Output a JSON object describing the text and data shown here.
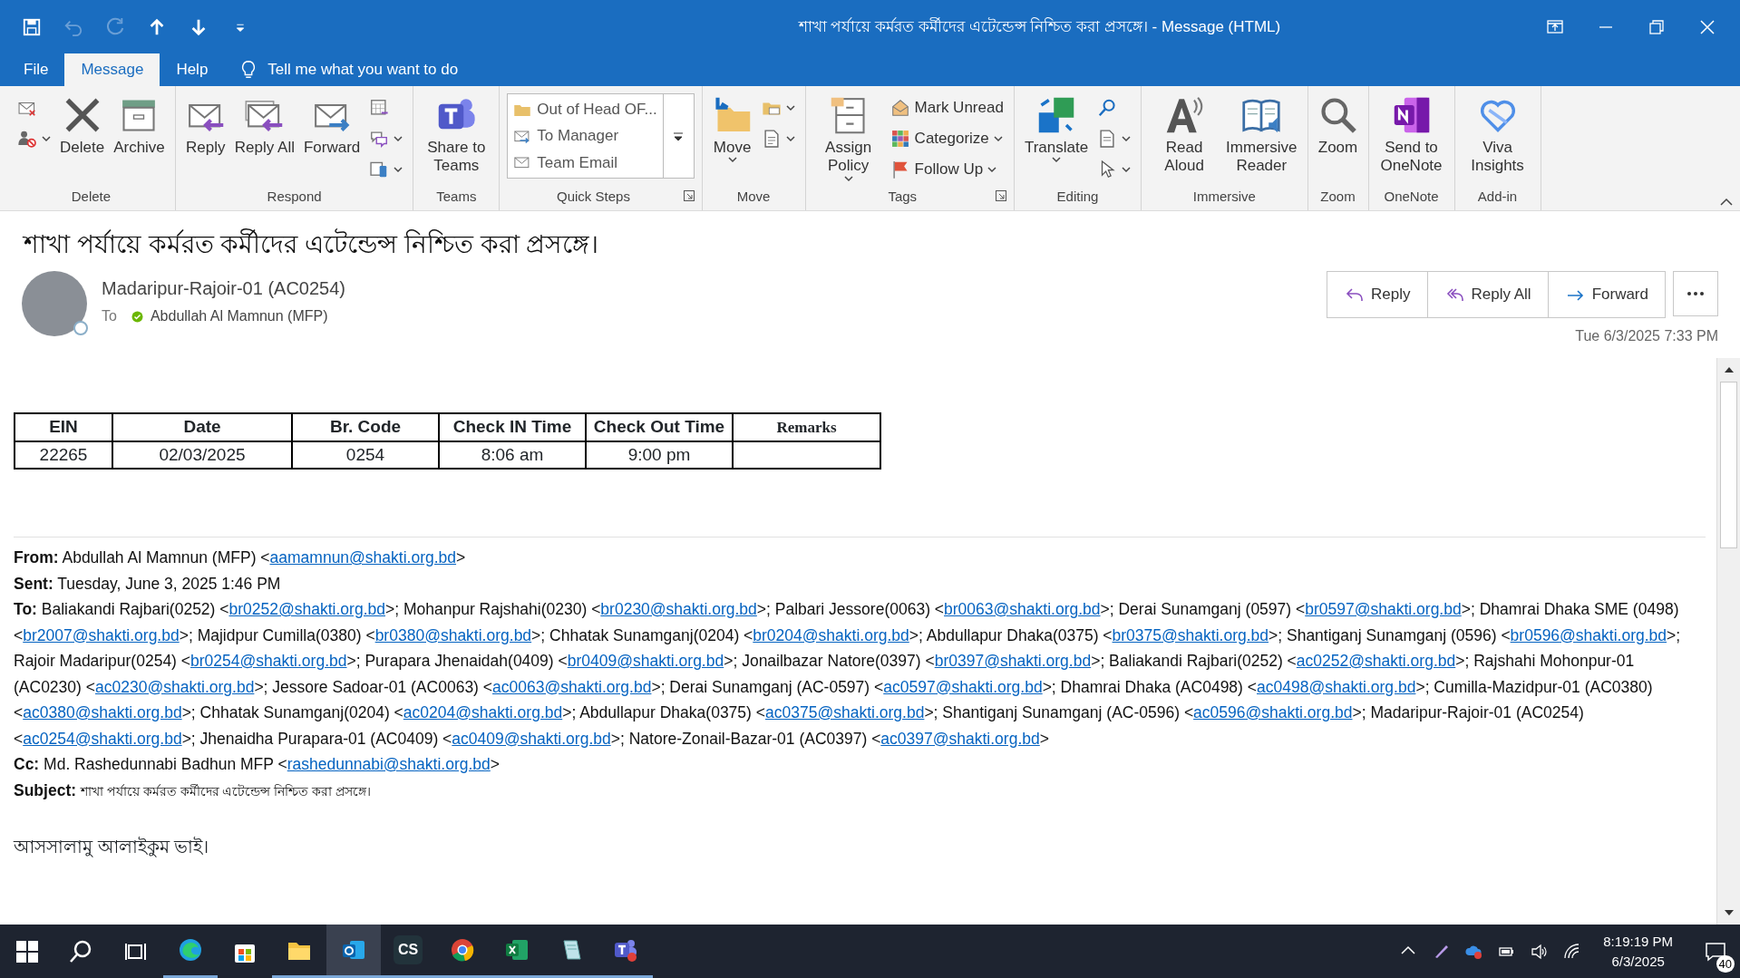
{
  "window": {
    "title": "শাখা পর্যায়ে কর্মরত কর্মীদের এটেন্ডেন্স নিশ্চিত করা প্রসঙ্গে।  -  Message (HTML)"
  },
  "quick_access": [
    {
      "disabled": false
    },
    {
      "disabled": true
    },
    {
      "disabled": true
    },
    {
      "disabled": false
    },
    {
      "disabled": false
    },
    {
      "disabled": false
    }
  ],
  "menu_tabs": [
    {
      "label": "File",
      "selected": false
    },
    {
      "label": "Message",
      "selected": true
    },
    {
      "label": "Help",
      "selected": false
    }
  ],
  "tell_me": {
    "placeholder": "Tell me what you want to do"
  },
  "ribbon_groups": [
    {
      "label": "Delete",
      "launcher": false,
      "items": [
        {
          "kind": "stack",
          "items": [
            {
              "dropdown": false
            },
            {
              "dropdown": true
            }
          ]
        },
        {
          "kind": "large",
          "label": "Delete",
          "dropdown": false
        },
        {
          "kind": "large",
          "label": "Archive",
          "dropdown": false
        }
      ]
    },
    {
      "label": "Respond",
      "launcher": false,
      "items": [
        {
          "kind": "large",
          "label": "Reply",
          "dropdown": false
        },
        {
          "kind": "large",
          "label": "Reply All",
          "dropdown": false
        },
        {
          "kind": "large",
          "label": "Forward",
          "dropdown": false
        },
        {
          "kind": "stack",
          "items": [
            {
              "dropdown": false
            },
            {
              "dropdown": true
            },
            {
              "dropdown": true
            }
          ]
        }
      ]
    },
    {
      "label": "Teams",
      "launcher": false,
      "items": [
        {
          "kind": "large",
          "label": "Share to Teams",
          "dropdown": false
        }
      ]
    },
    {
      "label": "Quick Steps",
      "launcher": true,
      "items": [
        {
          "kind": "gallery",
          "items": [
            {
              "label": "Out of Head OF..."
            },
            {
              "label": "To Manager"
            },
            {
              "label": "Team Email"
            }
          ]
        }
      ]
    },
    {
      "label": "Move",
      "launcher": false,
      "items": [
        {
          "kind": "large",
          "label": "Move",
          "dropdown": true
        },
        {
          "kind": "stack",
          "items": [
            {
              "dropdown": true
            },
            {
              "dropdown": true
            }
          ]
        }
      ]
    },
    {
      "label": "Tags",
      "launcher": true,
      "items": [
        {
          "kind": "large",
          "label": "Assign Policy",
          "dropdown": true
        },
        {
          "kind": "stack",
          "items": [
            {
              "label": "Mark Unread",
              "dropdown": false
            },
            {
              "label": "Categorize",
              "dropdown": true
            },
            {
              "label": "Follow Up",
              "dropdown": true
            }
          ]
        }
      ]
    },
    {
      "label": "Editing",
      "launcher": false,
      "items": [
        {
          "kind": "large",
          "label": "Translate",
          "dropdown": true
        },
        {
          "kind": "stack",
          "items": [
            {
              "dropdown": false
            },
            {
              "dropdown": true
            },
            {
              "dropdown": true
            }
          ]
        }
      ]
    },
    {
      "label": "Immersive",
      "launcher": false,
      "items": [
        {
          "kind": "large",
          "label": "Read Aloud",
          "dropdown": false
        },
        {
          "kind": "large",
          "label": "Immersive Reader",
          "dropdown": false
        }
      ]
    },
    {
      "label": "Zoom",
      "launcher": false,
      "items": [
        {
          "kind": "large",
          "label": "Zoom",
          "dropdown": false
        }
      ]
    },
    {
      "label": "OneNote",
      "launcher": false,
      "items": [
        {
          "kind": "large",
          "label": "Send to OneNote",
          "dropdown": false
        }
      ]
    },
    {
      "label": "Add-in",
      "launcher": false,
      "items": [
        {
          "kind": "large",
          "label": "Viva Insights",
          "dropdown": false
        }
      ]
    }
  ],
  "message": {
    "subject": "শাখা পর্যায়ে কর্মরত কর্মীদের এটেন্ডেন্স নিশ্চিত করা প্রসঙ্গে।",
    "sender": "Madaripur-Rajoir-01 (AC0254)",
    "to_label": "To",
    "recipient": "Abdullah Al Mamnun (MFP)",
    "actions": [
      {
        "label": "Reply"
      },
      {
        "label": "Reply All"
      },
      {
        "label": "Forward"
      }
    ],
    "date": "Tue 6/3/2025 7:33 PM"
  },
  "table": {
    "columns": [
      "EIN",
      "Date",
      "Br. Code",
      "Check IN Time",
      "Check Out Time",
      "Remarks"
    ],
    "rows": [
      [
        "22265",
        "02/03/2025",
        "0254",
        "8:06 am",
        "9:00 pm",
        ""
      ]
    ]
  },
  "forward_header": [
    {
      "label": "From:",
      "segments": [
        {
          "kind": "text",
          "text": "Abdullah Al Mamnun (MFP) <"
        },
        {
          "kind": "link",
          "text": "aamamnun@shakti.org.bd"
        },
        {
          "kind": "text",
          "text": ">"
        }
      ]
    },
    {
      "label": "Sent:",
      "segments": [
        {
          "kind": "text",
          "text": "Tuesday, June 3, 2025 1:46 PM"
        }
      ]
    },
    {
      "label": "To:",
      "segments": [
        {
          "kind": "text",
          "text": "Baliakandi Rajbari(0252) <"
        },
        {
          "kind": "link",
          "text": "br0252@shakti.org.bd"
        },
        {
          "kind": "text",
          "text": ">; Mohanpur Rajshahi(0230) <"
        },
        {
          "kind": "link",
          "text": "br0230@shakti.org.bd"
        },
        {
          "kind": "text",
          "text": ">; Palbari Jessore(0063) <"
        },
        {
          "kind": "link",
          "text": "br0063@shakti.org.bd"
        },
        {
          "kind": "text",
          "text": ">; Derai Sunamganj (0597) <"
        },
        {
          "kind": "link",
          "text": "br0597@shakti.org.bd"
        },
        {
          "kind": "text",
          "text": ">; Dhamrai Dhaka SME (0498) <"
        },
        {
          "kind": "link",
          "text": "br2007@shakti.org.bd"
        },
        {
          "kind": "text",
          "text": ">; Majidpur Cumilla(0380) <"
        },
        {
          "kind": "link",
          "text": "br0380@shakti.org.bd"
        },
        {
          "kind": "text",
          "text": ">; Chhatak Sunamganj(0204) <"
        },
        {
          "kind": "link",
          "text": "br0204@shakti.org.bd"
        },
        {
          "kind": "text",
          "text": ">; Abdullapur Dhaka(0375) <"
        },
        {
          "kind": "link",
          "text": "br0375@shakti.org.bd"
        },
        {
          "kind": "text",
          "text": ">; Shantiganj Sunamganj (0596) <"
        },
        {
          "kind": "link",
          "text": "br0596@shakti.org.bd"
        },
        {
          "kind": "text",
          "text": ">; Rajoir Madaripur(0254) <"
        },
        {
          "kind": "link",
          "text": "br0254@shakti.org.bd"
        },
        {
          "kind": "text",
          "text": ">; Purapara Jhenaidah(0409) <"
        },
        {
          "kind": "link",
          "text": "br0409@shakti.org.bd"
        },
        {
          "kind": "text",
          "text": ">; Jonailbazar Natore(0397) <"
        },
        {
          "kind": "link",
          "text": "br0397@shakti.org.bd"
        },
        {
          "kind": "text",
          "text": ">; Baliakandi Rajbari(0252) <"
        },
        {
          "kind": "link",
          "text": "ac0252@shakti.org.bd"
        },
        {
          "kind": "text",
          "text": ">; Rajshahi Mohonpur-01 (AC0230) <"
        },
        {
          "kind": "link",
          "text": "ac0230@shakti.org.bd"
        },
        {
          "kind": "text",
          "text": ">; Jessore Sadoar-01 (AC0063) <"
        },
        {
          "kind": "link",
          "text": "ac0063@shakti.org.bd"
        },
        {
          "kind": "text",
          "text": ">; Derai Sunamganj (AC-0597) <"
        },
        {
          "kind": "link",
          "text": "ac0597@shakti.org.bd"
        },
        {
          "kind": "text",
          "text": ">; Dhamrai Dhaka (AC0498) <"
        },
        {
          "kind": "link",
          "text": "ac0498@shakti.org.bd"
        },
        {
          "kind": "text",
          "text": ">; Cumilla-Mazidpur-01 (AC0380) <"
        },
        {
          "kind": "link",
          "text": "ac0380@shakti.org.bd"
        },
        {
          "kind": "text",
          "text": ">; Chhatak Sunamganj(0204) <"
        },
        {
          "kind": "link",
          "text": "ac0204@shakti.org.bd"
        },
        {
          "kind": "text",
          "text": ">; Abdullapur Dhaka(0375) <"
        },
        {
          "kind": "link",
          "text": "ac0375@shakti.org.bd"
        },
        {
          "kind": "text",
          "text": ">; Shantiganj Sunamganj (AC-0596) <"
        },
        {
          "kind": "link",
          "text": "ac0596@shakti.org.bd"
        },
        {
          "kind": "text",
          "text": ">; Madaripur-Rajoir-01 (AC0254) <"
        },
        {
          "kind": "link",
          "text": "ac0254@shakti.org.bd"
        },
        {
          "kind": "text",
          "text": ">; Jhenaidha Purapara-01 (AC0409) <"
        },
        {
          "kind": "link",
          "text": "ac0409@shakti.org.bd"
        },
        {
          "kind": "text",
          "text": ">; Natore-Zonail-Bazar-01 (AC0397) <"
        },
        {
          "kind": "link",
          "text": "ac0397@shakti.org.bd"
        },
        {
          "kind": "text",
          "text": ">"
        }
      ]
    },
    {
      "label": "Cc:",
      "segments": [
        {
          "kind": "text",
          "text": "Md. Rashedunnabi Badhun MFP <"
        },
        {
          "kind": "link",
          "text": "rashedunnabi@shakti.org.bd"
        },
        {
          "kind": "text",
          "text": ">"
        }
      ]
    },
    {
      "label": "Subject:",
      "segments": [
        {
          "kind": "small",
          "text": "শাখা পর্যায়ে কর্মরত কর্মীদের এটেন্ডেন্স নিশ্চিত করা প্রসঙ্গে।"
        }
      ]
    }
  ],
  "greeting": "আসসালামু  আলাইকুম  ভাই।",
  "taskbar": {
    "apps": [
      {
        "open": true,
        "selected": false
      },
      {
        "open": false,
        "selected": false
      },
      {
        "open": true,
        "selected": false
      },
      {
        "open": true,
        "selected": true
      },
      {
        "open": true,
        "selected": false,
        "label": "CS"
      },
      {
        "open": true,
        "selected": false
      },
      {
        "open": true,
        "selected": false
      },
      {
        "open": true,
        "selected": false
      },
      {
        "open": true,
        "selected": false
      }
    ],
    "time": "8:19:19 PM",
    "date": "6/3/2025",
    "notifications": "40"
  }
}
